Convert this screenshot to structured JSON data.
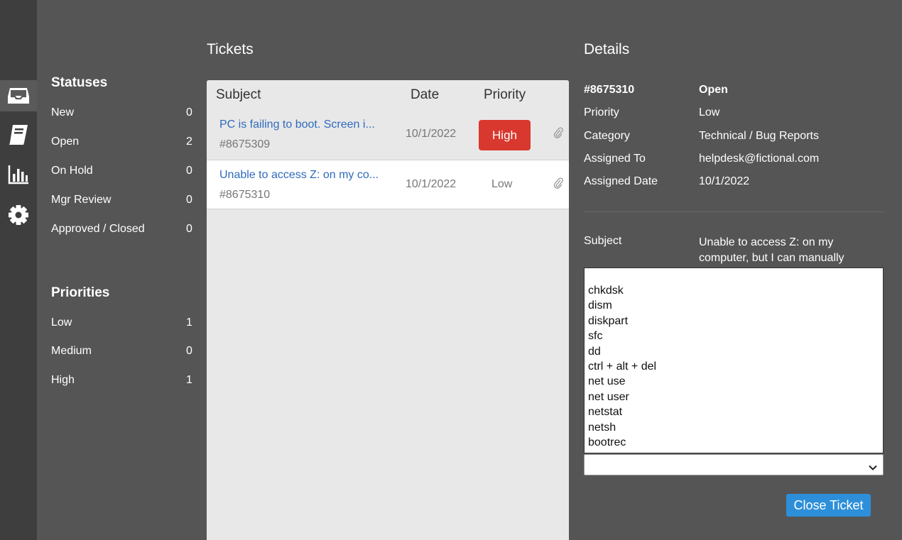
{
  "rail": {
    "icons": [
      "inbox-icon",
      "book-icon",
      "bar-chart-icon",
      "gear-icon"
    ]
  },
  "statuses": {
    "title": "Statuses",
    "items": [
      {
        "label": "New",
        "count": "0"
      },
      {
        "label": "Open",
        "count": "2"
      },
      {
        "label": "On Hold",
        "count": "0"
      },
      {
        "label": "Mgr Review",
        "count": "0"
      },
      {
        "label": "Approved / Closed",
        "count": "0"
      }
    ]
  },
  "priorities": {
    "title": "Priorities",
    "items": [
      {
        "label": "Low",
        "count": "1"
      },
      {
        "label": "Medium",
        "count": "0"
      },
      {
        "label": "High",
        "count": "1"
      }
    ]
  },
  "tickets": {
    "title": "Tickets",
    "columns": {
      "subject": "Subject",
      "date": "Date",
      "priority": "Priority"
    },
    "rows": [
      {
        "subject": "PC is failing to boot. Screen i...",
        "id": "#8675309",
        "date": "10/1/2022",
        "priority": "High",
        "priority_color": "#d9382e",
        "attachment_icon": "paperclip-icon"
      },
      {
        "subject": "Unable to access Z: on my co...",
        "id": "#8675310",
        "date": "10/1/2022",
        "priority": "Low",
        "attachment_icon": "paperclip-icon"
      }
    ]
  },
  "details": {
    "title": "Details",
    "id": "#8675310",
    "status": "Open",
    "fields": [
      {
        "key": "Priority",
        "value": "Low"
      },
      {
        "key": "Category",
        "value": "Technical / Bug Reports"
      },
      {
        "key": "Assigned To",
        "value": "helpdesk@fictional.com"
      },
      {
        "key": "Assigned Date",
        "value": "10/1/2022"
      }
    ],
    "subject_label": "Subject",
    "subject_value": "Unable to access Z: on my computer, but I can manually",
    "commands": [
      "chkdsk",
      "dism",
      "diskpart",
      "sfc",
      "dd",
      "ctrl + alt + del",
      "net use",
      "net user",
      "netstat",
      "netsh",
      "bootrec"
    ],
    "select_value": "",
    "close_button": "Close Ticket",
    "accent_color": "#2d8fd9"
  }
}
